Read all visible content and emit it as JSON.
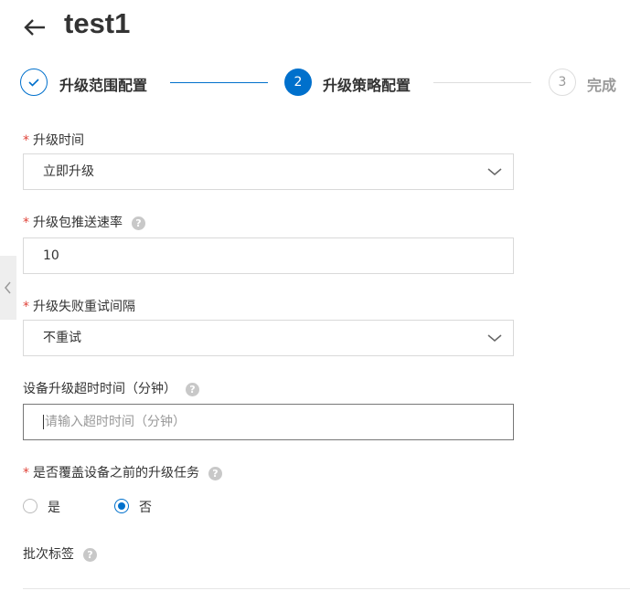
{
  "header": {
    "title": "test1"
  },
  "steps": [
    {
      "number": "1",
      "label": "升级范围配置",
      "state": "done"
    },
    {
      "number": "2",
      "label": "升级策略配置",
      "state": "active"
    },
    {
      "number": "3",
      "label": "完成",
      "state": "pending"
    }
  ],
  "form": {
    "upgrade_time": {
      "label": "升级时间",
      "value": "立即升级"
    },
    "push_rate": {
      "label": "升级包推送速率",
      "value": "10"
    },
    "retry_interval": {
      "label": "升级失败重试间隔",
      "value": "不重试"
    },
    "timeout": {
      "label": "设备升级超时时间（分钟）",
      "placeholder": "请输入超时时间（分钟）"
    },
    "override": {
      "label": "是否覆盖设备之前的升级任务",
      "options": [
        "是",
        "否"
      ],
      "selected": "否"
    },
    "batch_tag": {
      "label": "批次标签"
    }
  },
  "required_mark": "*",
  "help_mark": "?",
  "colors": {
    "accent": "#0070cc"
  }
}
